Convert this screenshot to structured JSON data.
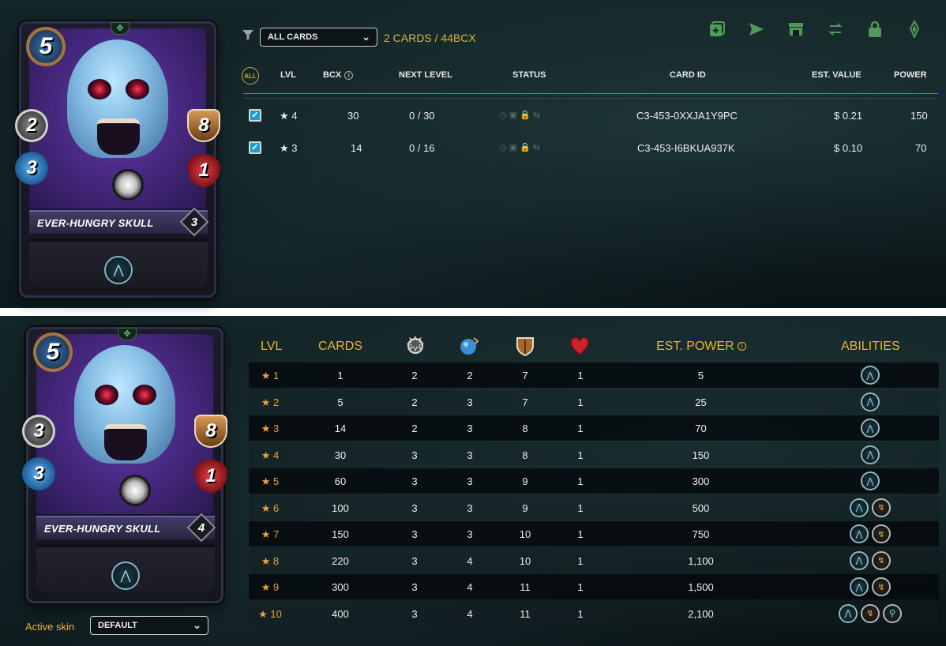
{
  "card": {
    "name": "EVER-HUNGRY SKULL",
    "mana": "5",
    "top": {
      "melee": "2",
      "magic": "3",
      "armor": "8",
      "health": "1",
      "level": "3"
    },
    "bottom": {
      "melee": "3",
      "magic": "3",
      "armor": "8",
      "health": "1",
      "level": "4"
    }
  },
  "collection": {
    "filter_value": "ALL CARDS",
    "count_label": "2 CARDS / 44BCX",
    "toolbar_icons": [
      "combine-icon",
      "send-icon",
      "market-icon",
      "transfer-icon",
      "lock-icon",
      "burn-icon"
    ],
    "headers": {
      "all": "ALL",
      "lvl": "LVL",
      "bcx": "BCX",
      "next_level": "NEXT LEVEL",
      "status": "STATUS",
      "card_id": "CARD ID",
      "est_value": "EST. VALUE",
      "power": "POWER"
    },
    "rows": [
      {
        "checked": true,
        "lvl": "★ 4",
        "bcx": "30",
        "next_level": "0 / 30",
        "card_id": "C3-453-0XXJA1Y9PC",
        "est_value": "$ 0.21",
        "power": "150"
      },
      {
        "checked": true,
        "lvl": "★ 3",
        "bcx": "14",
        "next_level": "0 / 16",
        "card_id": "C3-453-I6BKUA937K",
        "est_value": "$ 0.10",
        "power": "70"
      }
    ]
  },
  "levels": {
    "headers": {
      "lvl": "LVL",
      "cards": "CARDS",
      "est_power": "EST. POWER",
      "abilities": "ABILITIES"
    },
    "stat_icons": [
      "melee-icon",
      "magic-icon",
      "armor-icon",
      "health-icon"
    ],
    "rows": [
      {
        "lvl": "1",
        "cards": "1",
        "melee": "2",
        "magic": "2",
        "armor": "7",
        "health": "1",
        "power": "5",
        "abilities": [
          "flying"
        ]
      },
      {
        "lvl": "2",
        "cards": "5",
        "melee": "2",
        "magic": "3",
        "armor": "7",
        "health": "1",
        "power": "25",
        "abilities": [
          "flying"
        ]
      },
      {
        "lvl": "3",
        "cards": "14",
        "melee": "2",
        "magic": "3",
        "armor": "8",
        "health": "1",
        "power": "70",
        "abilities": [
          "flying"
        ]
      },
      {
        "lvl": "4",
        "cards": "30",
        "melee": "3",
        "magic": "3",
        "armor": "8",
        "health": "1",
        "power": "150",
        "abilities": [
          "flying"
        ]
      },
      {
        "lvl": "5",
        "cards": "60",
        "melee": "3",
        "magic": "3",
        "armor": "9",
        "health": "1",
        "power": "300",
        "abilities": [
          "flying"
        ]
      },
      {
        "lvl": "6",
        "cards": "100",
        "melee": "3",
        "magic": "3",
        "armor": "9",
        "health": "1",
        "power": "500",
        "abilities": [
          "flying",
          "ability-2"
        ]
      },
      {
        "lvl": "7",
        "cards": "150",
        "melee": "3",
        "magic": "3",
        "armor": "10",
        "health": "1",
        "power": "750",
        "abilities": [
          "flying",
          "ability-2"
        ]
      },
      {
        "lvl": "8",
        "cards": "220",
        "melee": "3",
        "magic": "4",
        "armor": "10",
        "health": "1",
        "power": "1,100",
        "abilities": [
          "flying",
          "ability-2"
        ]
      },
      {
        "lvl": "9",
        "cards": "300",
        "melee": "3",
        "magic": "4",
        "armor": "11",
        "health": "1",
        "power": "1,500",
        "abilities": [
          "flying",
          "ability-2"
        ]
      },
      {
        "lvl": "10",
        "cards": "400",
        "melee": "3",
        "magic": "4",
        "armor": "11",
        "health": "1",
        "power": "2,100",
        "abilities": [
          "flying",
          "ability-2",
          "ability-3"
        ]
      }
    ]
  },
  "skin": {
    "label": "Active skin",
    "value": "DEFAULT"
  },
  "colors": {
    "accent_gold": "#e9b534",
    "star": "#e9a43a",
    "toolbar_green": "#4e9a58",
    "checkbox_blue": "#1a9fd1"
  }
}
